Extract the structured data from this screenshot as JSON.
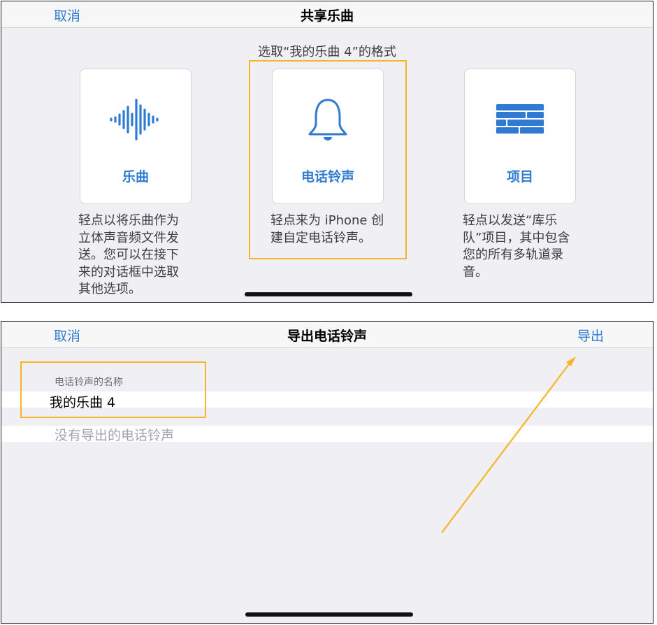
{
  "share_sheet": {
    "nav": {
      "cancel": "取消",
      "title": "共享乐曲"
    },
    "subtitle": "选取“我的乐曲 4”的格式",
    "options": [
      {
        "label": "乐曲",
        "icon": "waveform-icon",
        "description": "轻点以将乐曲作为立体声音频文件发送。您可以在接下来的对话框中选取其他选项。"
      },
      {
        "label": "电话铃声",
        "icon": "bell-icon",
        "description": "轻点来为 iPhone 创建自定电话铃声。"
      },
      {
        "label": "项目",
        "icon": "bricks-icon",
        "description": "轻点以发送“库乐队”项目，其中包含您的所有多轨道录音。"
      }
    ]
  },
  "export_sheet": {
    "nav": {
      "cancel": "取消",
      "title": "导出电话铃声",
      "export": "导出"
    },
    "name_field": {
      "label": "电话铃声的名称",
      "value": "我的乐曲 4"
    },
    "empty_message": "没有导出的电话铃声"
  },
  "colors": {
    "accent": "#2f7ad3",
    "highlight": "#f5b526"
  }
}
